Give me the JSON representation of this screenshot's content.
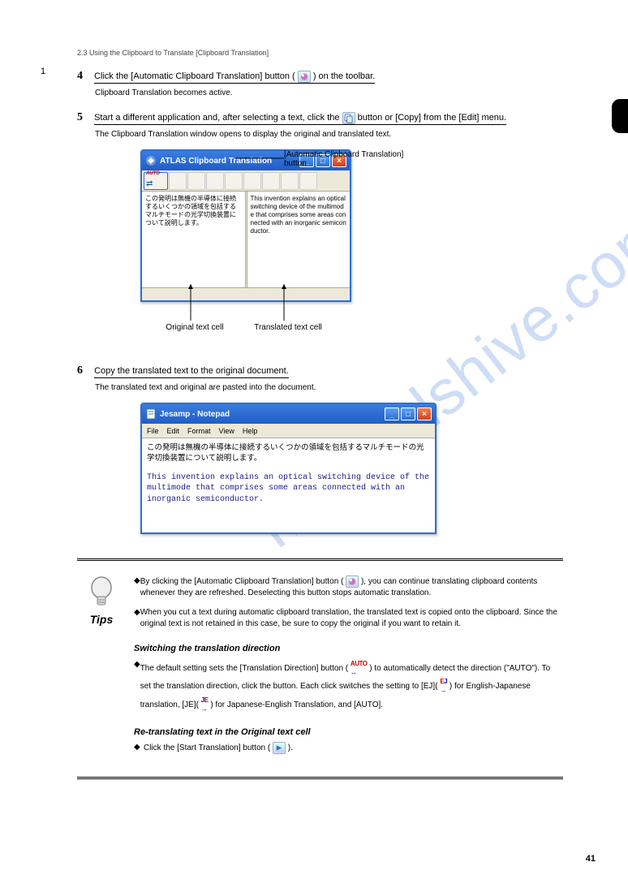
{
  "header": {
    "breadcrumb": "2.3 Using the Clipboard to Translate [Clipboard Translation]"
  },
  "section": "1",
  "page_number": "41",
  "steps": {
    "s4": {
      "num": "4",
      "text_a": "Click the [Automatic Clipboard Translation] button (",
      "text_b": ") on the toolbar.",
      "body": "Clipboard Translation becomes active."
    },
    "s5": {
      "num": "5",
      "text_a": "Start a different application and, after selecting a text, click the",
      "text_b": "button or [Copy] from the [Edit] menu.",
      "body": "The Clipboard Translation window opens to display the original and translated text."
    },
    "s6": {
      "num": "6",
      "text_a": "Copy the translated text to the original document.",
      "body": "The translated text and original are pasted into the document."
    }
  },
  "win1": {
    "title": "ATLAS Clipboard Translation",
    "pane_left": "この発明は無機の半導体に接続するいくつかの領域を包括するマルチモードの光学切換装置について説明します。",
    "pane_right": "This invention explains an optical switching device of the multimode that comprises some areas connected with an inorganic semiconductor."
  },
  "callouts": {
    "auto_btn": "[Automatic Clipboard Translation] button",
    "orig_cell": "Original text cell",
    "trans_cell": "Translated text cell"
  },
  "win2": {
    "title": "Jesamp - Notepad",
    "menu": {
      "file": "File",
      "edit": "Edit",
      "format": "Format",
      "view": "View",
      "help": "Help"
    },
    "jp": "この発明は無機の半導体に接続するいくつかの領域を包括するマルチモードの光学切換装置について説明します。",
    "en": "This invention explains an optical switching device of the multimode that comprises some areas connected with an inorganic semiconductor."
  },
  "tips": {
    "label": "Tips",
    "p1a": "By clicking the [Automatic Clipboard Translation] button (",
    "p1b": "), you can continue translating clipboard contents whenever they are refreshed. Deselecting this button stops automatic translation.",
    "p2": "When you cut a text during automatic clipboard translation, the translated text is copied onto the clipboard. Since the original text is not retained in this case, be sure to copy the original if you want to retain it.",
    "h1": "Switching the translation direction",
    "h1b": "The default setting sets the [Translation Direction] button (",
    "h1c": ") to automatically detect the direction (\"AUTO\"). To set the translation direction, click the button. Each click switches the setting to [EJ](",
    "h1d": ") for English-Japanese translation, [JE](",
    "h1e": ") for Japanese-English Translation, and [AUTO].",
    "h2": "Re-translating text in the Original text cell",
    "h2b_a": "Click the [Start Translation] button (",
    "h2b_b": ")."
  },
  "watermark": "manualshive.com"
}
